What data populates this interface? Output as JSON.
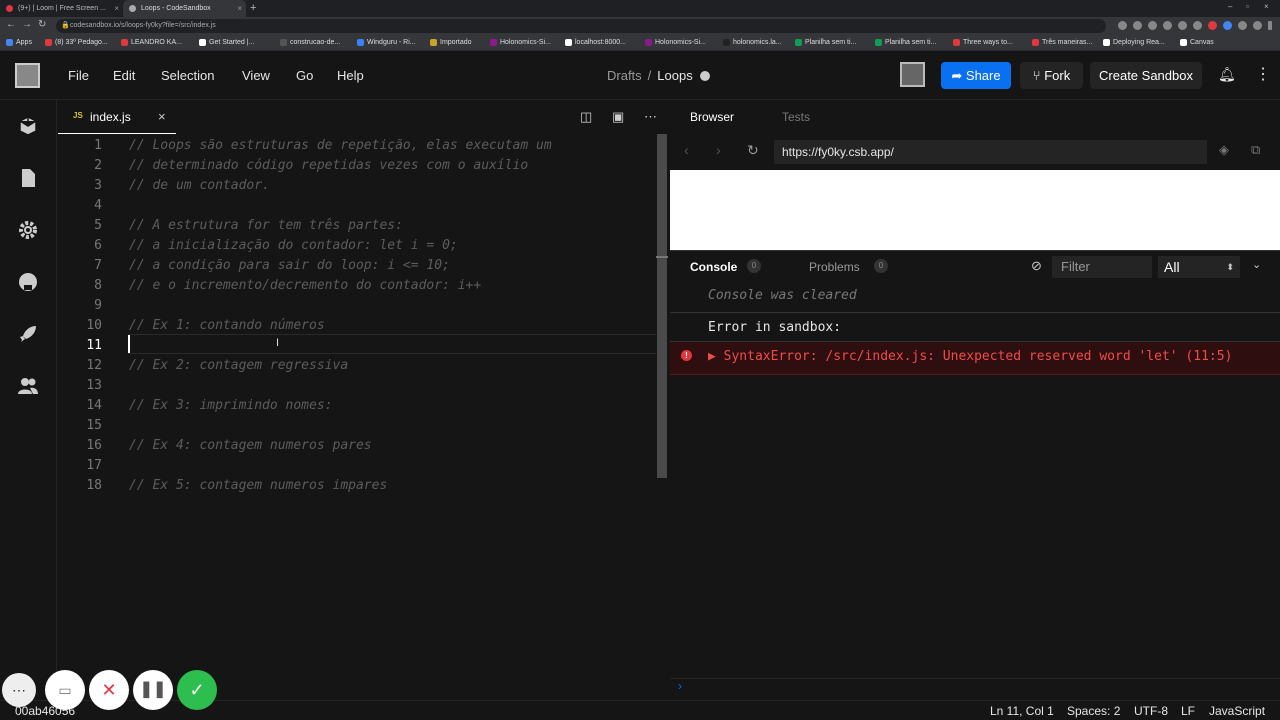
{
  "browser": {
    "tabs": [
      {
        "label": "(9+) | Loom | Free Screen ...",
        "color": "#e1373f"
      },
      {
        "label": "Loops - CodeSandbox",
        "color": "#aaaaaa"
      }
    ],
    "new_tab": "+",
    "url": "codesandbox.io/s/loops-fy0ky?file=/src/index.js",
    "bookmarks": [
      {
        "label": "Apps",
        "color": "#4285f4"
      },
      {
        "label": "(8) 33º Pedago...",
        "color": "#e1373f"
      },
      {
        "label": "LEANDRO KA...",
        "color": "#e1373f"
      },
      {
        "label": "Get Started |...",
        "color": "#ffffff"
      },
      {
        "label": "construcao-de...",
        "color": "#555555"
      },
      {
        "label": "Windguru - Ri...",
        "color": "#3b82f6"
      },
      {
        "label": "Importado",
        "color": "#c9a227"
      },
      {
        "label": "Holonomics-Si...",
        "color": "#8b1a8b"
      },
      {
        "label": "localhost:8000...",
        "color": "#ffffff"
      },
      {
        "label": "Holonomics-Si...",
        "color": "#8b1a8b"
      },
      {
        "label": "holonomics.la...",
        "color": "#222222"
      },
      {
        "label": "Planilha sem ti...",
        "color": "#0f9d58"
      },
      {
        "label": "Planilha sem ti...",
        "color": "#0f9d58"
      },
      {
        "label": "Three ways to...",
        "color": "#e1373f"
      },
      {
        "label": "Três maneiras...",
        "color": "#e1373f"
      },
      {
        "label": "Deploying Rea...",
        "color": "#ffffff"
      },
      {
        "label": "Canvas",
        "color": "#ffffff"
      }
    ]
  },
  "header": {
    "menu": [
      "File",
      "Edit",
      "Selection",
      "View",
      "Go",
      "Help"
    ],
    "breadcrumb_folder": "Drafts",
    "breadcrumb_sep": "/",
    "sandbox_name": "Loops",
    "share_label": "Share",
    "fork_label": "Fork",
    "create_label": "Create Sandbox",
    "accent": "#0971f1"
  },
  "editor": {
    "tab_icon": "JS",
    "filename": "index.js",
    "close": "×",
    "cursor_line": 11,
    "lines": [
      "// Loops são estruturas de repetição, elas executam um",
      "// determinado código repetidas vezes com o auxílio",
      "// de um contador.",
      "",
      "// A estrutura for tem três partes:",
      "// a inicialização do contador: let i = 0;",
      "// a condição para sair do loop: i <= 10;",
      "// e o incremento/decremento do contador: i++",
      "",
      "// Ex 1: contando números",
      "",
      "// Ex 2: contagem regressiva",
      "",
      "// Ex 3: imprimindo nomes:",
      "",
      "// Ex 4: contagem numeros pares",
      "",
      "// Ex 5: contagem numeros impares"
    ],
    "line_numbers": [
      "1",
      "2",
      "3",
      "4",
      "5",
      "6",
      "7",
      "8",
      "9",
      "10",
      "11",
      "12",
      "13",
      "14",
      "15",
      "16",
      "17",
      "18"
    ]
  },
  "preview": {
    "tab_browser": "Browser",
    "tab_tests": "Tests",
    "url": "https://fy0ky.csb.app/"
  },
  "console": {
    "tab_console": "Console",
    "console_count": "0",
    "tab_problems": "Problems",
    "problems_count": "0",
    "filter_placeholder": "Filter",
    "level": "All",
    "cleared_msg": "Console was cleared",
    "error_header": "Error in sandbox:",
    "error_msg": "SyntaxError: /src/index.js: Unexpected reserved word 'let' (11:5)",
    "prompt": "›",
    "error_color": "#f14c4c"
  },
  "status": {
    "left": "00ab46056",
    "position": "Ln 11, Col 1",
    "spaces": "Spaces: 2",
    "encoding": "UTF-8",
    "eol": "LF",
    "language": "JavaScript"
  }
}
